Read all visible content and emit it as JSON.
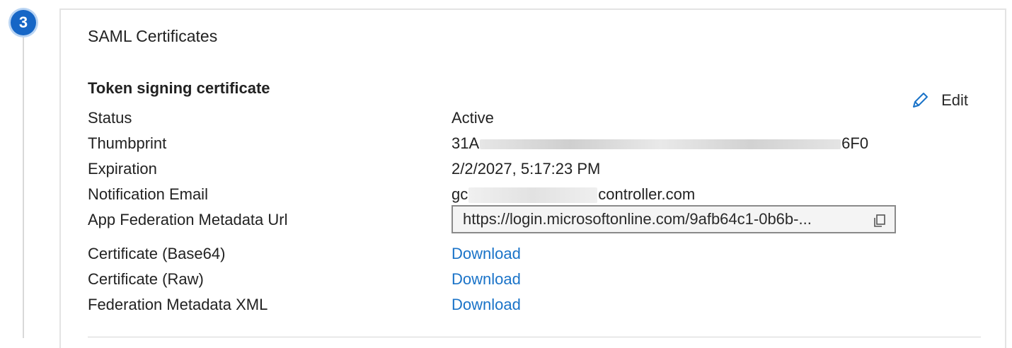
{
  "step": {
    "number": "3"
  },
  "card": {
    "title": "SAML Certificates",
    "section_title": "Token signing certificate",
    "edit_label": "Edit"
  },
  "fields": {
    "status": {
      "label": "Status",
      "value": "Active"
    },
    "thumbprint": {
      "label": "Thumbprint",
      "prefix": "31A",
      "suffix": "6F0"
    },
    "expiration": {
      "label": "Expiration",
      "value": "2/2/2027, 5:17:23 PM"
    },
    "notification_email": {
      "label": "Notification Email",
      "prefix": "gc",
      "suffix": "controller.com"
    },
    "metadata_url": {
      "label": "App Federation Metadata Url",
      "value": "https://login.microsoftonline.com/9afb64c1-0b6b-..."
    },
    "cert_base64": {
      "label": "Certificate (Base64)",
      "link": "Download"
    },
    "cert_raw": {
      "label": "Certificate (Raw)",
      "link": "Download"
    },
    "federation_xml": {
      "label": "Federation Metadata XML",
      "link": "Download"
    }
  },
  "icons": {
    "edit": "pencil-icon",
    "copy": "copy-icon"
  },
  "colors": {
    "accent": "#1666c6",
    "link": "#1a73c8"
  }
}
